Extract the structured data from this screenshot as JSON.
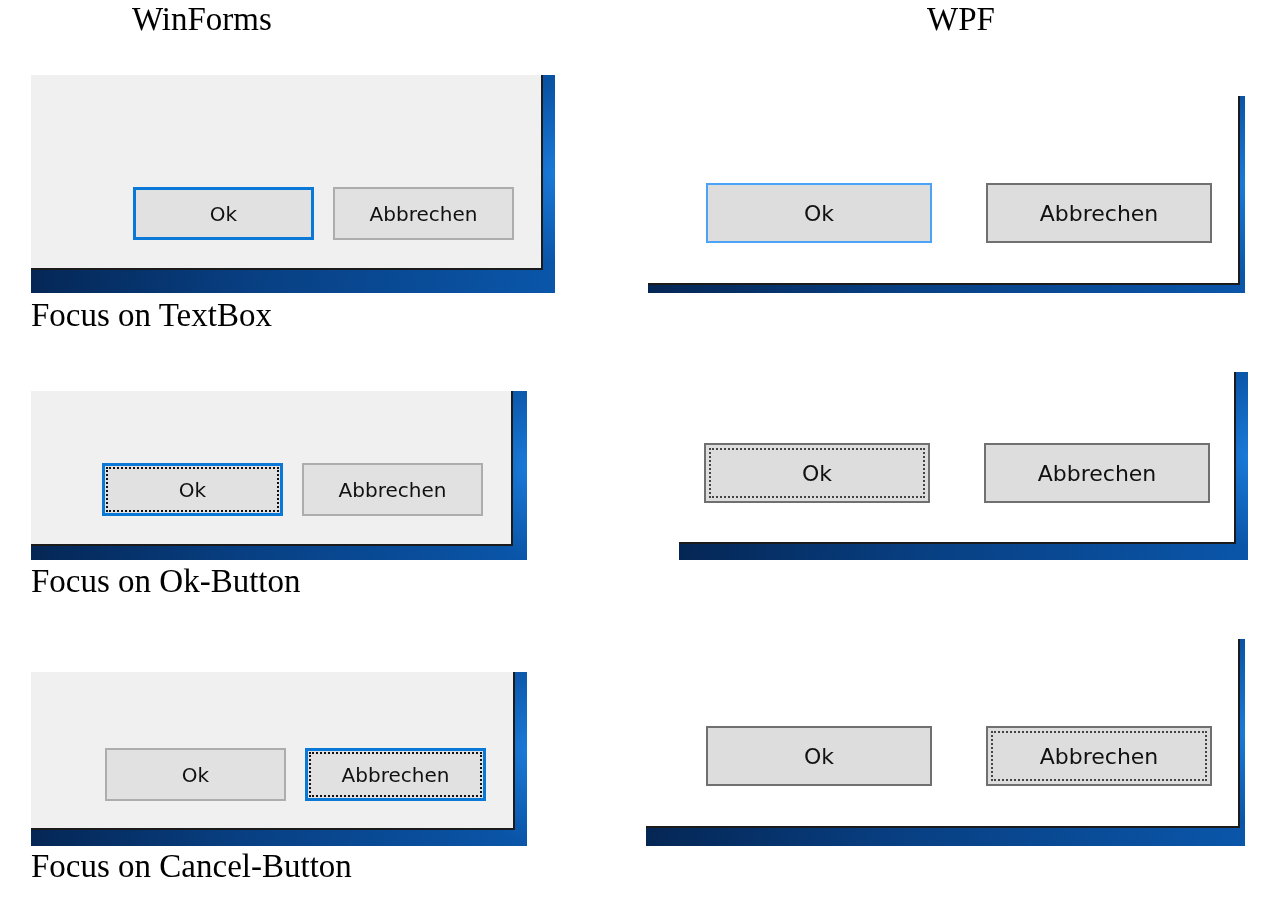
{
  "columns": [
    {
      "title": "WinForms",
      "kind": "winforms",
      "examples": [
        {
          "buttons": [
            {
              "label": "Ok",
              "highlighted": true,
              "focused": false
            },
            {
              "label": "Abbrechen",
              "highlighted": false,
              "focused": false
            }
          ],
          "caption": "Focus on TextBox"
        },
        {
          "buttons": [
            {
              "label": "Ok",
              "highlighted": true,
              "focused": true
            },
            {
              "label": "Abbrechen",
              "highlighted": false,
              "focused": false
            }
          ],
          "caption": "Focus on Ok-Button"
        },
        {
          "buttons": [
            {
              "label": "Ok",
              "highlighted": false,
              "focused": false
            },
            {
              "label": "Abbrechen",
              "highlighted": true,
              "focused": true
            }
          ],
          "caption": "Focus on Cancel-Button"
        }
      ]
    },
    {
      "title": "WPF",
      "kind": "wpf",
      "examples": [
        {
          "buttons": [
            {
              "label": "Ok",
              "highlighted": true,
              "focused": false
            },
            {
              "label": "Abbrechen",
              "highlighted": false,
              "focused": false
            }
          ]
        },
        {
          "buttons": [
            {
              "label": "Ok",
              "highlighted": false,
              "focused": true
            },
            {
              "label": "Abbrechen",
              "highlighted": false,
              "focused": false
            }
          ]
        },
        {
          "buttons": [
            {
              "label": "Ok",
              "highlighted": false,
              "focused": false
            },
            {
              "label": "Abbrechen",
              "highlighted": false,
              "focused": true
            }
          ]
        }
      ]
    }
  ]
}
